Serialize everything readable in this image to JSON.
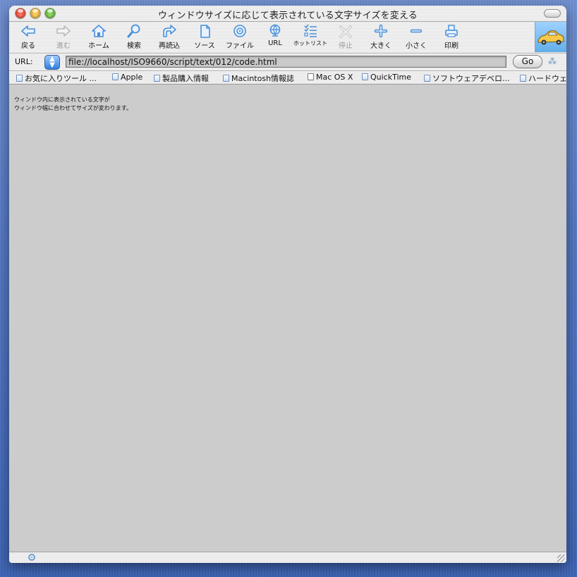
{
  "window": {
    "title": "ウィンドウサイズに応じて表示されている文字サイズを変える"
  },
  "toolbar": {
    "buttons": [
      {
        "label": "戻る",
        "icon": "back-arrow-icon",
        "enabled": true
      },
      {
        "label": "進む",
        "icon": "forward-arrow-icon",
        "enabled": false
      },
      {
        "label": "ホーム",
        "icon": "home-icon",
        "enabled": true
      },
      {
        "label": "検索",
        "icon": "search-icon",
        "enabled": true
      },
      {
        "label": "再読込",
        "icon": "refresh-icon",
        "enabled": true
      },
      {
        "label": "ソース",
        "icon": "source-document-icon",
        "enabled": true
      },
      {
        "label": "ファイル",
        "icon": "file-disc-icon",
        "enabled": true
      },
      {
        "label": "URL",
        "icon": "url-globe-icon",
        "enabled": true
      },
      {
        "label": "ホットリスト",
        "icon": "hotlist-icon",
        "enabled": true
      },
      {
        "label": "停止",
        "icon": "stop-x-icon",
        "enabled": false
      },
      {
        "label": "大きく",
        "icon": "plus-icon",
        "enabled": true
      },
      {
        "label": "小さく",
        "icon": "minus-icon",
        "enabled": true
      },
      {
        "label": "印刷",
        "icon": "printer-icon",
        "enabled": true
      }
    ]
  },
  "address": {
    "label": "URL:",
    "url": "file://localhost/ISO9660/script/text/012/code.html",
    "go_label": "Go"
  },
  "favorites": [
    {
      "label": "お気に入りツール ...",
      "icon": "folder-icon"
    },
    {
      "label": "Apple",
      "icon": "folder-icon"
    },
    {
      "label": "製品購入情報",
      "icon": "folder-icon"
    },
    {
      "label": "Macintosh情報誌",
      "icon": "folder-icon"
    },
    {
      "label": "Mac OS X",
      "icon": "page-icon"
    },
    {
      "label": "QuickTime",
      "icon": "folder-icon"
    },
    {
      "label": "ソフトウェアデベロ...",
      "icon": "folder-icon"
    },
    {
      "label": "ハードウェ",
      "icon": "folder-icon"
    }
  ],
  "content": {
    "line1": "ウィンドウ内に表示されている文字が",
    "line2": "ウィンドウ幅に合わせてサイズが変わります。"
  },
  "colors": {
    "accent": "#4a8fd6",
    "content_bg": "#cccccc",
    "desktop": "#4a6fbf"
  }
}
